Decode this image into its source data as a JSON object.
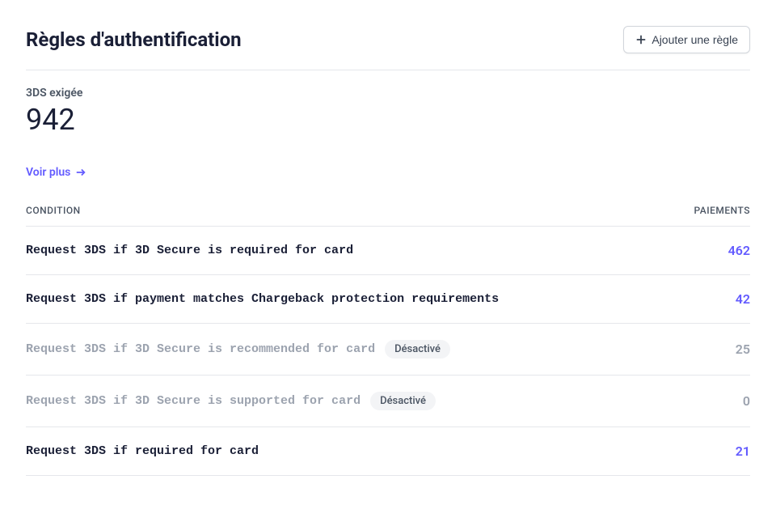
{
  "header": {
    "title": "Règles d'authentification",
    "add_button_label": "Ajouter une règle"
  },
  "stats": {
    "label": "3DS exigée",
    "value": "942"
  },
  "see_more_label": "Voir plus",
  "table": {
    "columns": {
      "condition": "CONDITION",
      "payments": "PAIEMENTS"
    },
    "rows": [
      {
        "condition": "Request 3DS if 3D Secure is required for card",
        "disabled": false,
        "badge": null,
        "payments": "462"
      },
      {
        "condition": "Request 3DS if payment matches Chargeback protection requirements",
        "disabled": false,
        "badge": null,
        "payments": "42"
      },
      {
        "condition": "Request 3DS if 3D Secure is recommended for card",
        "disabled": true,
        "badge": "Désactivé",
        "payments": "25"
      },
      {
        "condition": "Request 3DS if 3D Secure is supported for card",
        "disabled": true,
        "badge": "Désactivé",
        "payments": "0"
      },
      {
        "condition": "Request 3DS if required for card",
        "disabled": false,
        "badge": null,
        "payments": "21"
      }
    ]
  }
}
